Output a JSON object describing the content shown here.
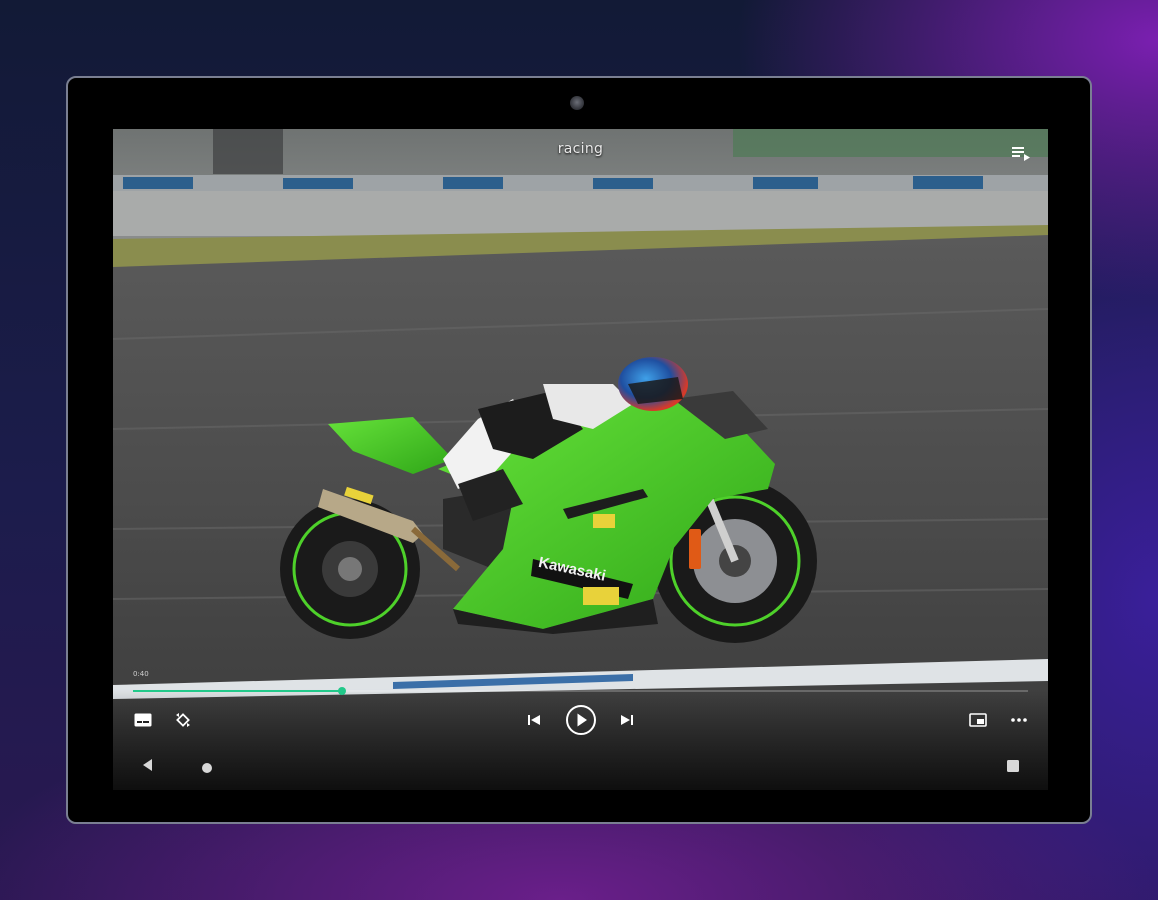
{
  "player": {
    "title": "racing",
    "elapsed": "0:40",
    "progress_fraction": 0.234
  },
  "icons": {
    "queue": "playlist-icon",
    "subtitles": "subtitles-icon",
    "rotate": "rotate-icon",
    "previous": "skip-previous-icon",
    "play": "play-icon",
    "next": "skip-next-icon",
    "pip": "picture-in-picture-icon",
    "more": "more-options-icon",
    "nav_back": "back-triangle-icon",
    "nav_home": "home-circle-icon",
    "nav_recents": "recents-square-icon"
  },
  "colors": {
    "accent": "#22c98a",
    "bike_green": "#4ed12a"
  }
}
